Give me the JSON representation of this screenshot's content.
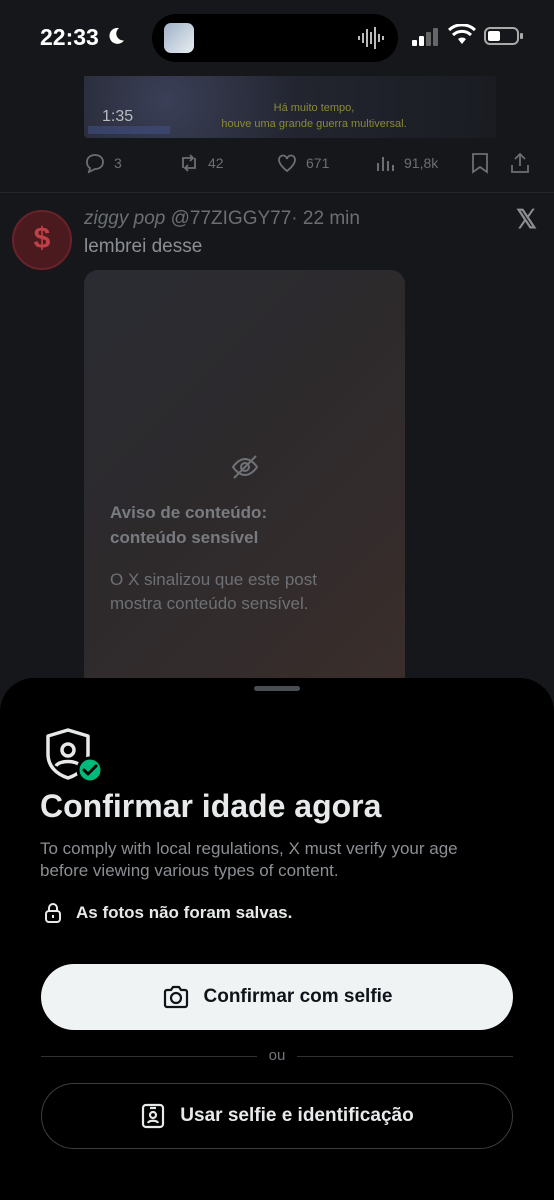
{
  "status_bar": {
    "time": "22:33"
  },
  "feed": {
    "video_caption_line1": "Há muito tempo,",
    "video_caption_line2": "houve uma grande guerra multiversal.",
    "video_time": "1:35",
    "actions": {
      "replies": "3",
      "reposts": "42",
      "likes": "671",
      "views": "91,8k"
    },
    "tweet": {
      "name": "ziggy pop",
      "handle": "@77ZIGGY77",
      "time": "· 22 min",
      "text": "lembrei desse",
      "avatar_letter": "$",
      "warning_title_line1": "Aviso de conteúdo:",
      "warning_title_line2": "conteúdo sensível",
      "warning_text_line1": "O X sinalizou que este post",
      "warning_text_line2": "mostra conteúdo sensível."
    }
  },
  "sheet": {
    "title": "Confirmar idade agora",
    "description": "To comply with local regulations, X must verify your age before viewing various types of content.",
    "privacy_note": "As fotos não foram salvas.",
    "primary_button": "Confirmar com selfie",
    "or_label": "ou",
    "secondary_button": "Usar selfie e identificação"
  },
  "colors": {
    "accent_green": "#00ba7c",
    "sheet_bg": "#000000",
    "primary_button_bg": "#eff3f4"
  }
}
